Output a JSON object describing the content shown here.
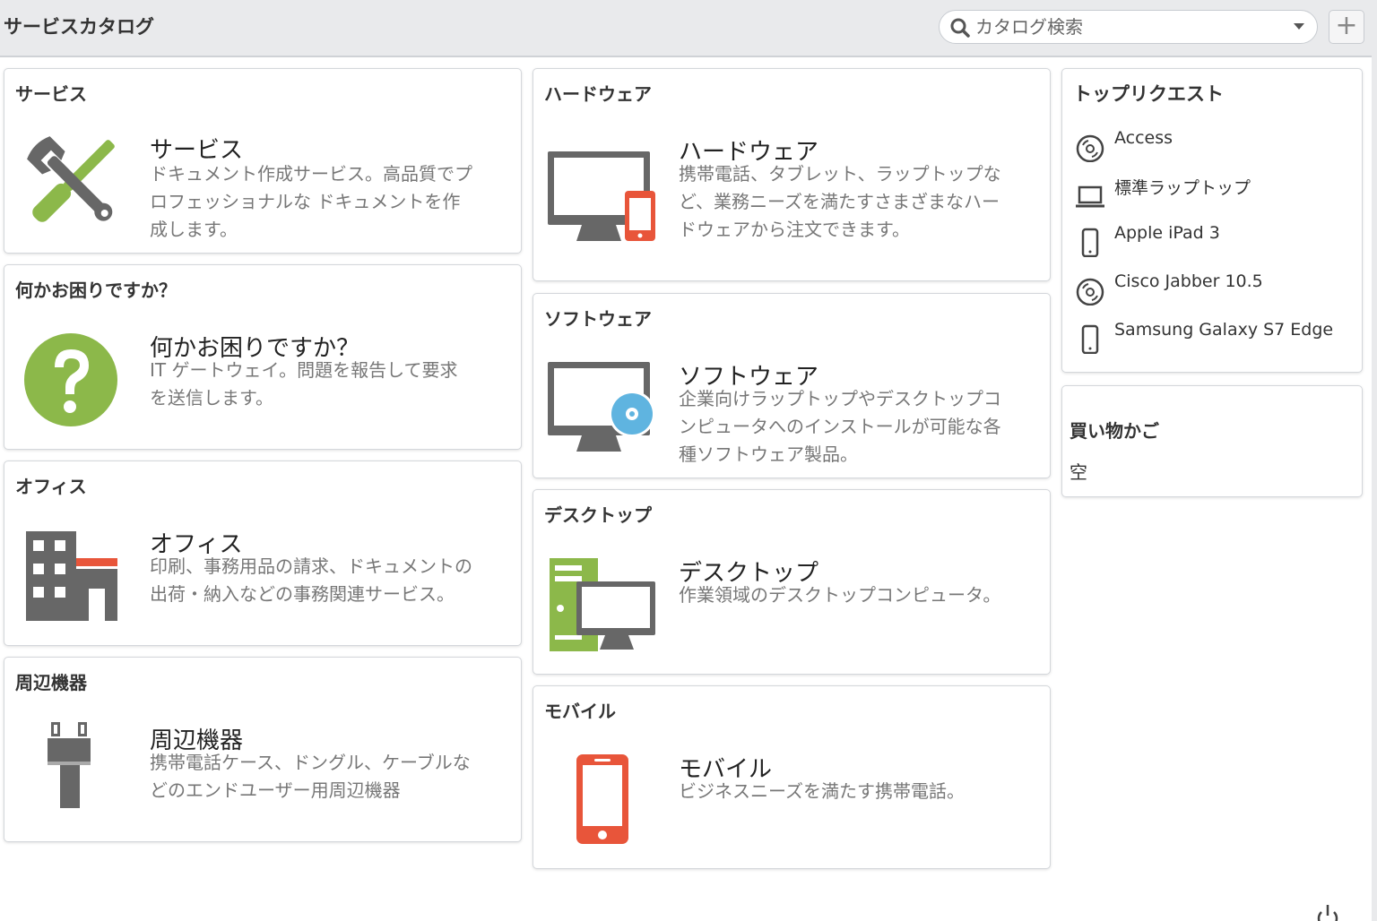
{
  "header": {
    "title": "サービスカタログ",
    "search_placeholder": "カタログ検索",
    "add_label": "+"
  },
  "catalog": {
    "left": [
      {
        "category": "サービス",
        "name": "サービス",
        "description": "ドキュメント作成サービス。高品質でプロフェッショナルな ドキュメントを作成します。",
        "icon": "wrench-screwdriver-icon"
      },
      {
        "category": "何かお困りですか？",
        "name": "何かお困りですか？",
        "description": "IT ゲートウェイ。問題を報告して要求を送信します。",
        "icon": "question-icon"
      },
      {
        "category": "オフィス",
        "name": "オフィス",
        "description": "印刷、事務用品の請求、ドキュメントの出荷・納入などの事務関連サービス。",
        "icon": "office-building-icon"
      },
      {
        "category": "周辺機器",
        "name": "周辺機器",
        "description": "携帯電話ケース、ドングル、ケーブルなどのエンドユーザー用周辺機器",
        "icon": "plug-icon"
      }
    ],
    "right": [
      {
        "category": "ハードウェア",
        "name": "ハードウェア",
        "description": "携帯電話、タブレット、ラップトップなど、業務ニーズを満たすさまざまなハードウェアから注文できます。",
        "icon": "monitor-phone-icon"
      },
      {
        "category": "ソフトウェア",
        "name": "ソフトウェア",
        "description": "企業向けラップトップやデスクトップコンピュータへのインストールが可能な各種ソフトウェア製品。",
        "icon": "monitor-disc-icon"
      },
      {
        "category": "デスクトップ",
        "name": "デスクトップ",
        "description": "作業領域のデスクトップコンピュータ。",
        "icon": "desktop-tower-icon"
      },
      {
        "category": "モバイル",
        "name": "モバイル",
        "description": "ビジネスニーズを満たす携帯電話。",
        "icon": "mobile-phone-icon"
      }
    ]
  },
  "top_requests": {
    "title": "トップリクエスト",
    "items": [
      {
        "label": "Access",
        "icon": "disc-icon"
      },
      {
        "label": "標準ラップトップ",
        "icon": "laptop-icon"
      },
      {
        "label": "Apple iPad 3",
        "icon": "phone-icon"
      },
      {
        "label": "Cisco Jabber 10.5",
        "icon": "disc-icon"
      },
      {
        "label": "Samsung Galaxy S7 Edge",
        "icon": "phone-icon"
      }
    ]
  },
  "cart": {
    "title": "買い物かご",
    "state": "空"
  },
  "colors": {
    "green": "#8cb84a",
    "gray_icon": "#676767",
    "orange_red": "#e8553a",
    "disc_blue": "#5fb4e0"
  }
}
